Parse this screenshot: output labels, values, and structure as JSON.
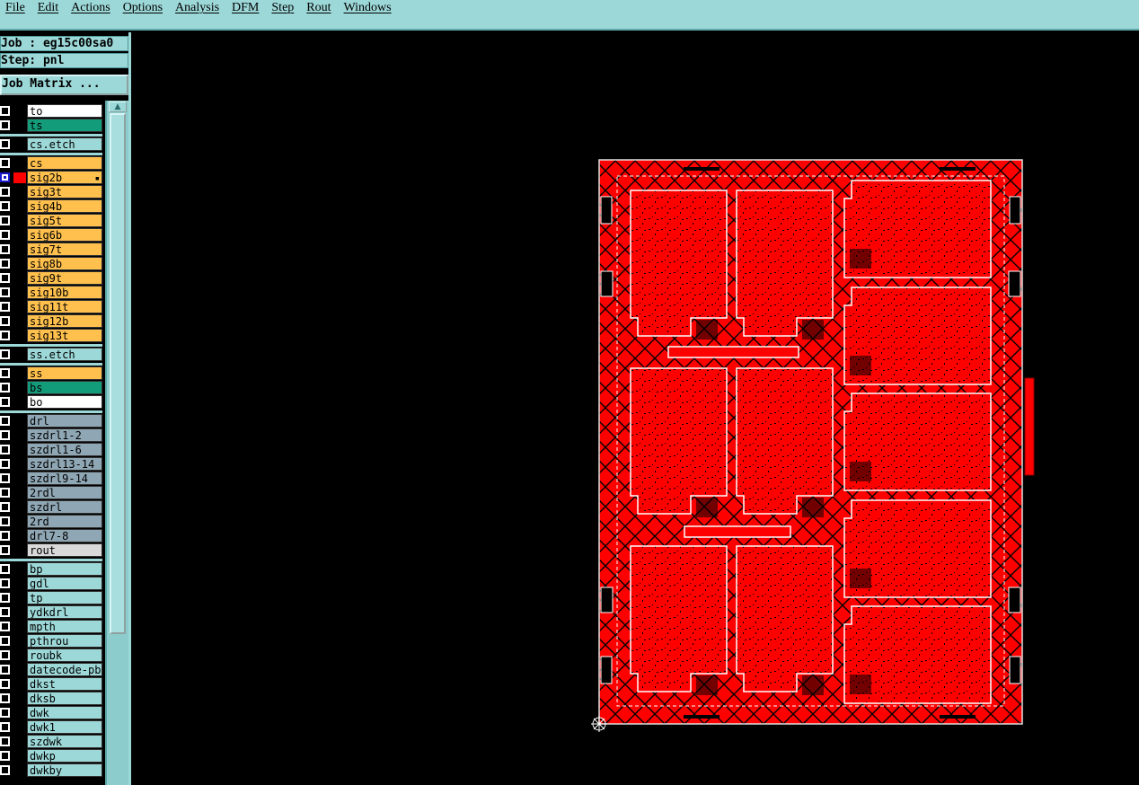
{
  "menubar": {
    "items": [
      "File",
      "Edit",
      "Actions",
      "Options",
      "Analysis",
      "DFM",
      "Step",
      "Rout",
      "Windows"
    ]
  },
  "job": {
    "job_label": "Job : eg15c00sa0",
    "step_label": "Step: pnl",
    "matrix_button": "Job Matrix ..."
  },
  "colors": {
    "cyan_panel": "#9dd8d8",
    "signal": "#ffc04d",
    "solder_mask": "#139c7a",
    "drill": "#8fa7b4",
    "rout": "#d9d9d9",
    "white": "#ffffff",
    "work_layer_red": "#ff0000"
  },
  "layers": [
    {
      "name": "to",
      "color": "white",
      "checked": false
    },
    {
      "name": "ts",
      "color": "solder_mask",
      "checked": false
    },
    {
      "name": "cs.etch",
      "color": "cyan_panel",
      "checked": false
    },
    {
      "name": "cs",
      "color": "signal",
      "checked": false
    },
    {
      "name": "sig2b",
      "color": "signal",
      "checked": true,
      "swatch": "work_layer_red",
      "pinned": true
    },
    {
      "name": "sig3t",
      "color": "signal",
      "checked": false
    },
    {
      "name": "sig4b",
      "color": "signal",
      "checked": false
    },
    {
      "name": "sig5t",
      "color": "signal",
      "checked": false
    },
    {
      "name": "sig6b",
      "color": "signal",
      "checked": false
    },
    {
      "name": "sig7t",
      "color": "signal",
      "checked": false
    },
    {
      "name": "sig8b",
      "color": "signal",
      "checked": false
    },
    {
      "name": "sig9t",
      "color": "signal",
      "checked": false
    },
    {
      "name": "sig10b",
      "color": "signal",
      "checked": false
    },
    {
      "name": "sig11t",
      "color": "signal",
      "checked": false
    },
    {
      "name": "sig12b",
      "color": "signal",
      "checked": false
    },
    {
      "name": "sig13t",
      "color": "signal",
      "checked": false
    },
    {
      "name": "ss.etch",
      "color": "cyan_panel",
      "checked": false
    },
    {
      "name": "ss",
      "color": "signal",
      "checked": false
    },
    {
      "name": "bs",
      "color": "solder_mask",
      "checked": false
    },
    {
      "name": "bo",
      "color": "white",
      "checked": false
    },
    {
      "name": "drl",
      "color": "drill",
      "checked": false
    },
    {
      "name": "szdrl1-2",
      "color": "drill",
      "checked": false
    },
    {
      "name": "szdrl1-6",
      "color": "drill",
      "checked": false
    },
    {
      "name": "szdrl13-14",
      "color": "drill",
      "checked": false
    },
    {
      "name": "szdrl9-14",
      "color": "drill",
      "checked": false
    },
    {
      "name": "2rdl",
      "color": "drill",
      "checked": false
    },
    {
      "name": "szdrl",
      "color": "drill",
      "checked": false
    },
    {
      "name": "2rd",
      "color": "drill",
      "checked": false
    },
    {
      "name": "drl7-8",
      "color": "drill",
      "checked": false
    },
    {
      "name": "rout",
      "color": "rout",
      "checked": false
    },
    {
      "name": "bp",
      "color": "cyan_panel",
      "checked": false
    },
    {
      "name": "gdl",
      "color": "cyan_panel",
      "checked": false
    },
    {
      "name": "tp",
      "color": "cyan_panel",
      "checked": false
    },
    {
      "name": "ydkdrl",
      "color": "cyan_panel",
      "checked": false
    },
    {
      "name": "mpth",
      "color": "cyan_panel",
      "checked": false
    },
    {
      "name": "pthrou",
      "color": "cyan_panel",
      "checked": false
    },
    {
      "name": "roubk",
      "color": "cyan_panel",
      "checked": false
    },
    {
      "name": "datecode-pbe",
      "color": "cyan_panel",
      "checked": false
    },
    {
      "name": "dkst",
      "color": "cyan_panel",
      "checked": false
    },
    {
      "name": "dksb",
      "color": "cyan_panel",
      "checked": false
    },
    {
      "name": "dwk",
      "color": "cyan_panel",
      "checked": false
    },
    {
      "name": "dwk1",
      "color": "cyan_panel",
      "checked": false
    },
    {
      "name": "szdwk",
      "color": "cyan_panel",
      "checked": false
    },
    {
      "name": "dwkp",
      "color": "cyan_panel",
      "checked": false
    },
    {
      "name": "dwkby",
      "color": "cyan_panel",
      "checked": false
    }
  ],
  "icons": {
    "scroll_up": "triangle-up",
    "datum": "crosshair-circle"
  }
}
